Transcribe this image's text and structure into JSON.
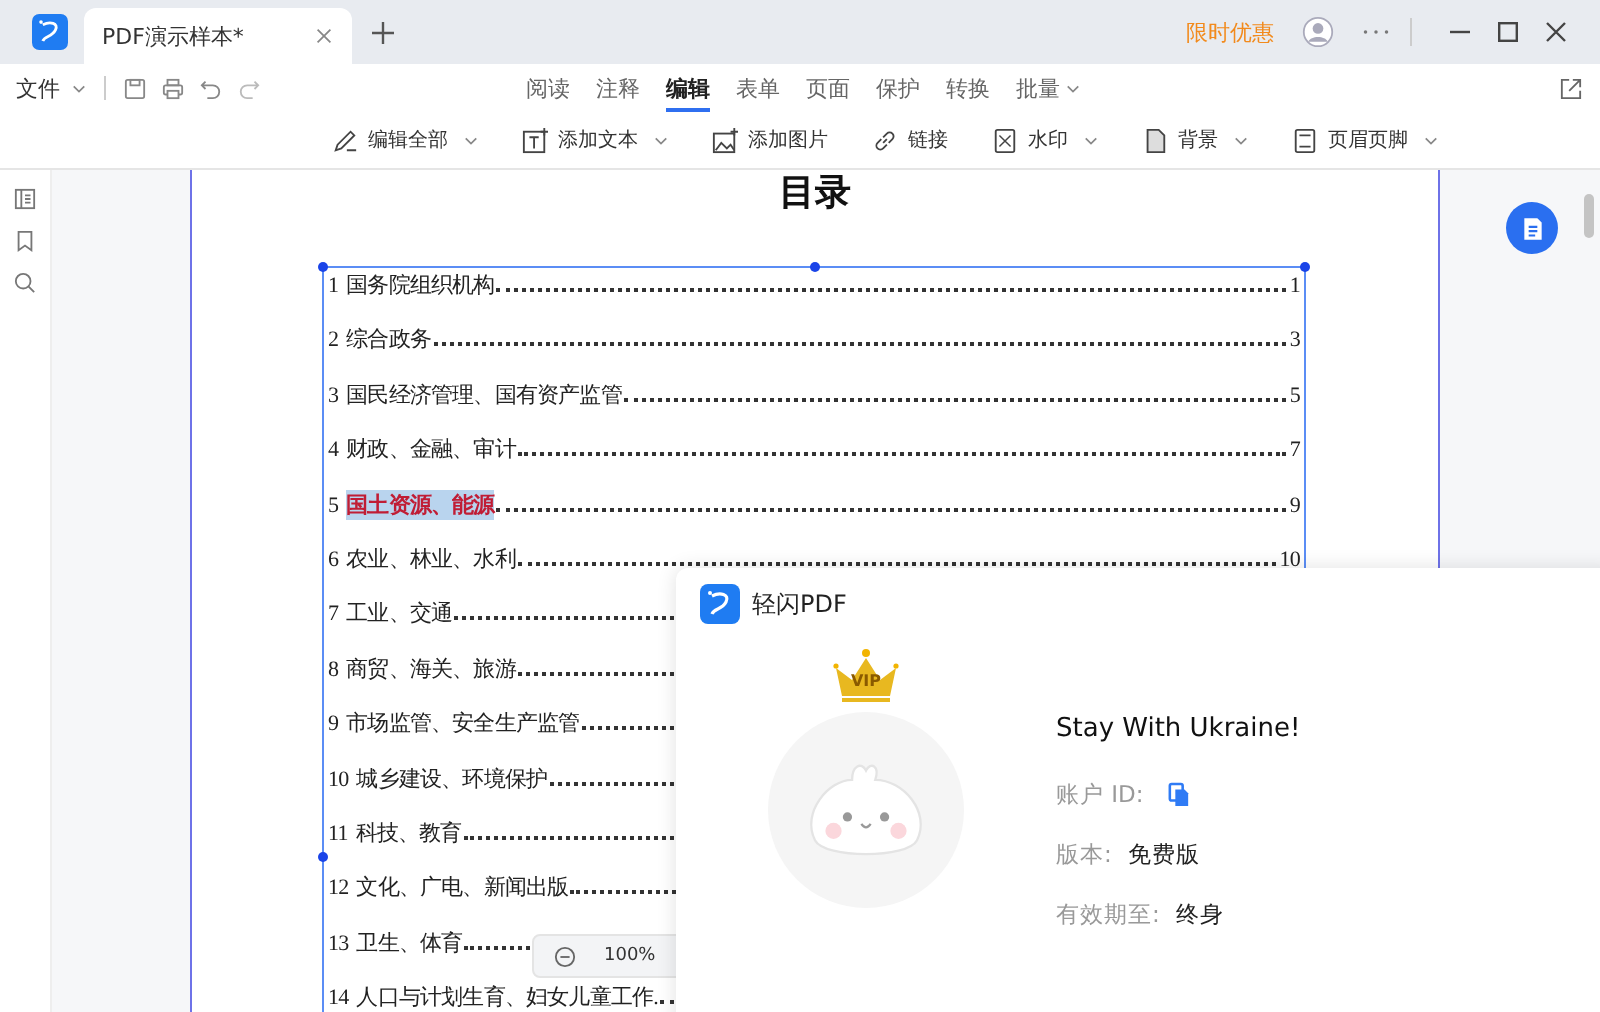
{
  "window": {
    "tab_title": "PDF演示样本*",
    "promo": "限时优惠"
  },
  "menu": {
    "file": "文件",
    "modes": [
      {
        "label": "阅读",
        "selected": false,
        "dropdown": false
      },
      {
        "label": "注释",
        "selected": false,
        "dropdown": false
      },
      {
        "label": "编辑",
        "selected": true,
        "dropdown": false
      },
      {
        "label": "表单",
        "selected": false,
        "dropdown": false
      },
      {
        "label": "页面",
        "selected": false,
        "dropdown": false
      },
      {
        "label": "保护",
        "selected": false,
        "dropdown": false
      },
      {
        "label": "转换",
        "selected": false,
        "dropdown": false
      },
      {
        "label": "批量",
        "selected": false,
        "dropdown": true
      }
    ]
  },
  "toolbar": [
    {
      "kind": "pen",
      "label": "编辑全部",
      "dropdown": true
    },
    {
      "kind": "text",
      "label": "添加文本",
      "dropdown": true
    },
    {
      "kind": "image",
      "label": "添加图片",
      "dropdown": false
    },
    {
      "kind": "link",
      "label": "链接",
      "dropdown": false
    },
    {
      "kind": "watermark",
      "label": "水印",
      "dropdown": true
    },
    {
      "kind": "background",
      "label": "背景",
      "dropdown": true
    },
    {
      "kind": "header",
      "label": "页眉页脚",
      "dropdown": true
    }
  ],
  "document": {
    "title": "目录",
    "toc": [
      {
        "number": "1",
        "title": "国务院组织机构",
        "page": "1",
        "selected": false
      },
      {
        "number": "2",
        "title": "综合政务",
        "page": "3",
        "selected": false
      },
      {
        "number": "3",
        "title": "国民经济管理、国有资产监管",
        "page": "5",
        "selected": false
      },
      {
        "number": "4",
        "title": "财政、金融、审计",
        "page": "7",
        "selected": false
      },
      {
        "number": "5",
        "title": "国土资源、能源",
        "page": "9",
        "selected": true
      },
      {
        "number": "6",
        "title": "农业、林业、水利",
        "page": "10",
        "selected": false
      },
      {
        "number": "7",
        "title": "工业、交通",
        "selected": false
      },
      {
        "number": "8",
        "title": "商贸、海关、旅游",
        "selected": false
      },
      {
        "number": "9",
        "title": "市场监管、安全生产监管",
        "selected": false
      },
      {
        "number": "10",
        "title": "城乡建设、环境保护",
        "selected": false
      },
      {
        "number": "11",
        "title": "科技、教育",
        "selected": false
      },
      {
        "number": "12",
        "title": "文化、广电、新闻出版",
        "selected": false
      },
      {
        "number": "13",
        "title": "卫生、体育",
        "selected": false
      },
      {
        "number": "14",
        "title": "人口与计划生育、妇女儿童工作.",
        "selected": false
      }
    ]
  },
  "zoom": {
    "value": "100%"
  },
  "about_dialog": {
    "app_name": "轻闪PDF",
    "badge": "VIP",
    "user_name": "Stay With Ukraine!",
    "fields": [
      {
        "label": "账户 ID:",
        "kind": "copy"
      },
      {
        "label": "版本:",
        "value": "免费版",
        "kind": "text"
      },
      {
        "label": "有效期至:",
        "value": "终身",
        "kind": "text"
      }
    ]
  }
}
